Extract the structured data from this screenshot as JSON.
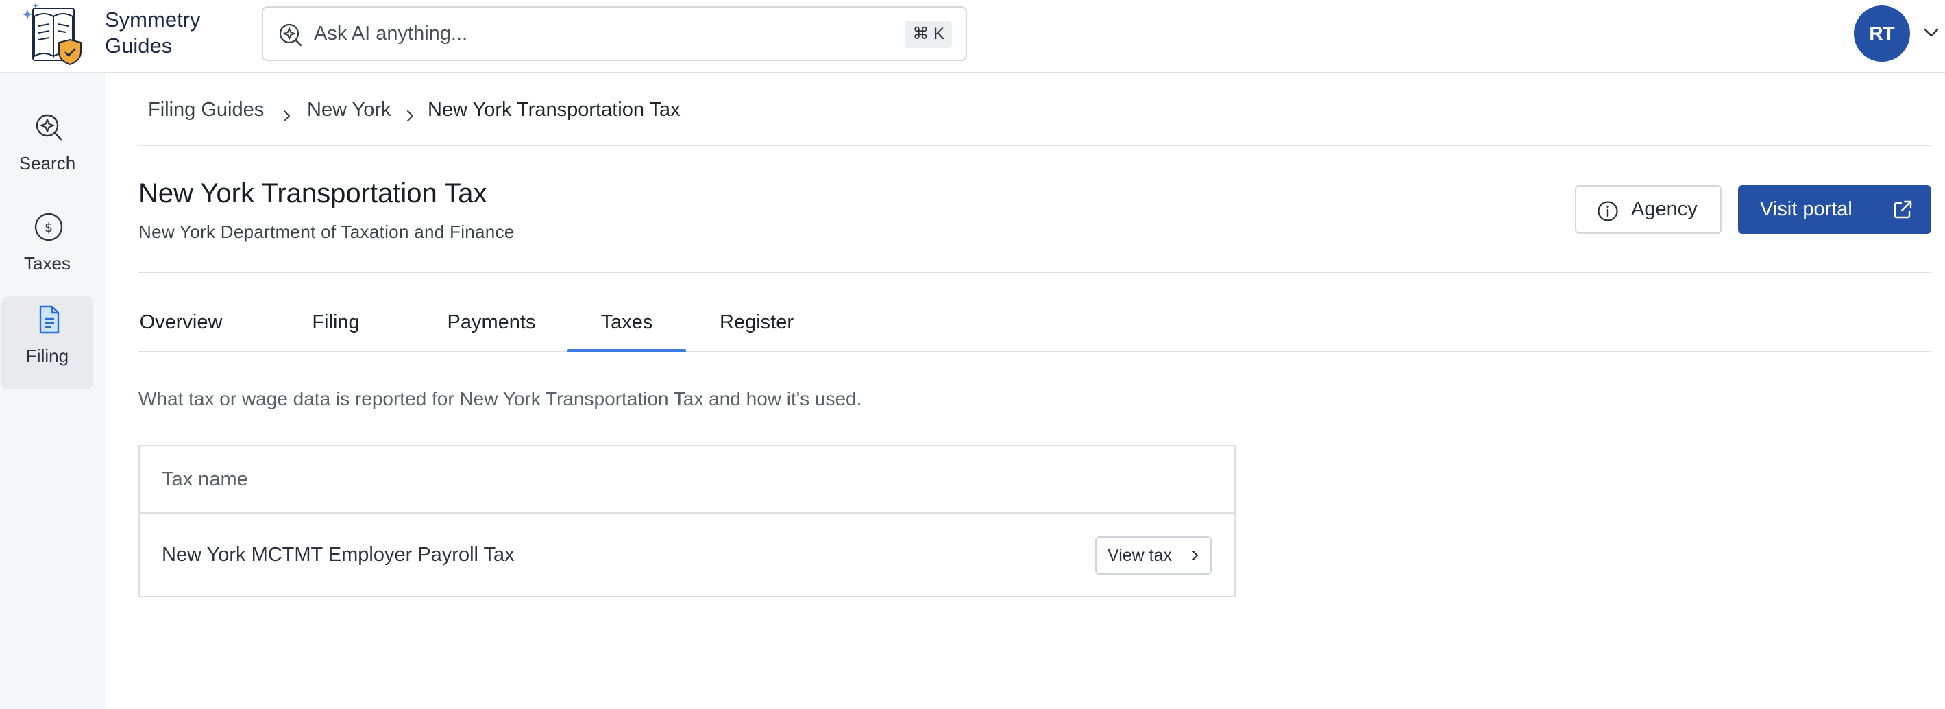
{
  "app": {
    "brand_line1": "Symmetry",
    "brand_line2": "Guides"
  },
  "search": {
    "placeholder": "Ask AI anything...",
    "shortcut": "⌘ K"
  },
  "user": {
    "initials": "RT"
  },
  "sidebar": {
    "items": [
      {
        "label": "Search",
        "icon": "search-sparkle-icon"
      },
      {
        "label": "Taxes",
        "icon": "dollar-circle-icon"
      },
      {
        "label": "Filing",
        "icon": "document-icon",
        "active": true
      }
    ]
  },
  "breadcrumb": {
    "items": [
      "Filing Guides",
      "New York",
      "New York Transportation Tax"
    ]
  },
  "page": {
    "title": "New York Transportation Tax",
    "subtitle": "New York Department of Taxation and Finance",
    "agency_label": "Agency",
    "portal_label": "Visit portal"
  },
  "tabs": [
    {
      "label": "Overview"
    },
    {
      "label": "Filing"
    },
    {
      "label": "Payments"
    },
    {
      "label": "Taxes",
      "active": true
    },
    {
      "label": "Register"
    }
  ],
  "taxes": {
    "description": "What tax or wage data is reported for New York Transportation Tax and how it's used.",
    "column_header": "Tax name",
    "rows": [
      {
        "name": "New York MCTMT Employer Payroll Tax",
        "action": "View tax"
      }
    ]
  },
  "colors": {
    "primary": "#2451a6",
    "tab_indicator": "#3d7de3",
    "sidebar_bg": "#f5f6f8",
    "logo_accent": "#f2a73b"
  }
}
